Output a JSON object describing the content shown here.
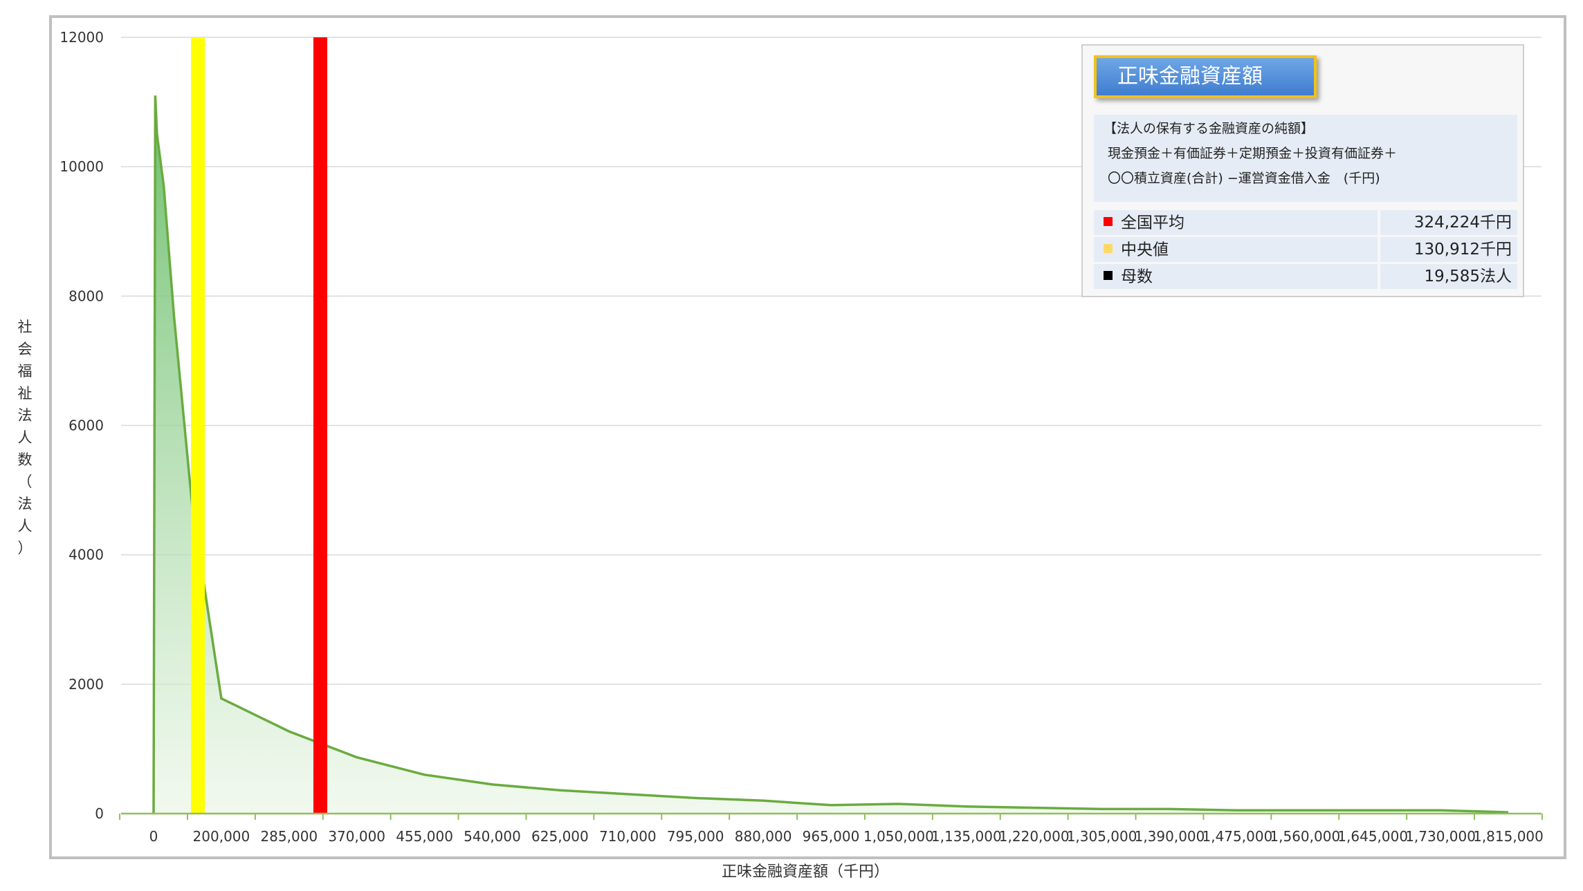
{
  "chart_data": {
    "type": "area",
    "xlabel": "正味金融資産額（千円）",
    "ylabel": "社会福祉法人数（法人）",
    "ylim": [
      0,
      12000
    ],
    "yticks": [
      0,
      2000,
      4000,
      6000,
      8000,
      10000,
      12000
    ],
    "xticks": [
      "0",
      "200,000",
      "285,000",
      "370,000",
      "455,000",
      "540,000",
      "625,000",
      "710,000",
      "795,000",
      "880,000",
      "965,000",
      "1,050,000",
      "1,135,000",
      "1,220,000",
      "1,305,000",
      "1,390,000",
      "1,475,000",
      "1,560,000",
      "1,645,000",
      "1,730,000",
      "1,815,000"
    ],
    "grid": true,
    "series": [
      {
        "type": "area",
        "x": [
          0,
          5000,
          10000,
          30000,
          60000,
          115000,
          200000,
          285000,
          370000,
          455000,
          540000,
          625000,
          710000,
          795000,
          880000,
          965000,
          1050000,
          1135000,
          1220000,
          1305000,
          1390000,
          1475000,
          1560000,
          1645000,
          1730000,
          1815000
        ],
        "y": [
          0,
          11100,
          10500,
          9700,
          7700,
          4700,
          1780,
          1270,
          870,
          600,
          450,
          360,
          300,
          240,
          200,
          130,
          150,
          110,
          90,
          70,
          70,
          50,
          50,
          50,
          50,
          20
        ],
        "color": "#6aab3f"
      }
    ],
    "reference_lines": [
      {
        "label": "中央値",
        "value": 130912,
        "color": "#ffff00"
      },
      {
        "label": "全国平均",
        "value": 324224,
        "color": "#ff0000"
      }
    ],
    "legend": "top-right"
  },
  "legend_box": {
    "title": "正味金融資産額",
    "desc_line1": "【法人の保有する金融資産の純額】",
    "desc_line2": "現金預金＋有価証券＋定期預金＋投資有価証券＋",
    "desc_line3": "〇〇積立資産(合計) −運営資金借入金　(千円)",
    "rows": [
      {
        "label": "全国平均",
        "value": "324,224千円",
        "color": "#ff0000"
      },
      {
        "label": "中央値",
        "value": "130,912千円",
        "color": "#ffd966"
      },
      {
        "label": "母数",
        "value": "19,585法人",
        "color": "#000000"
      }
    ]
  }
}
